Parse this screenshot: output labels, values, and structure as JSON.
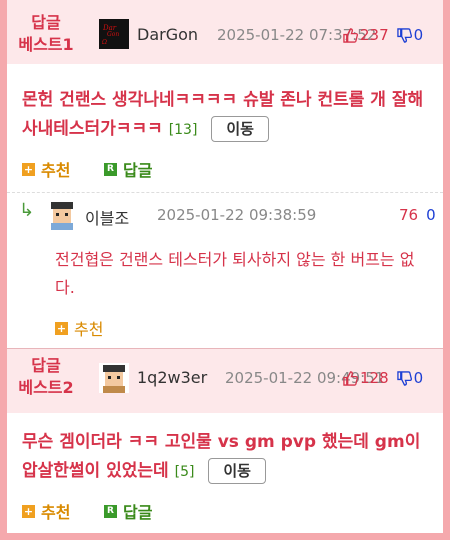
{
  "posts": [
    {
      "rank": "답글\n베스트1",
      "nick": "DarGon",
      "date": "2025-01-22 07:37:52",
      "up": "237",
      "down": "0",
      "title": "몬헌 건랜스 생각나네ㅋㅋㅋㅋ 슈발 존나 컨트롤 개 잘해 사내테스터가ㅋㅋㅋ",
      "count": "[13]",
      "move": "이동",
      "recommend": "추천",
      "reply": "답글"
    },
    {
      "rank": "답글\n베스트2",
      "nick": "1q2w3er",
      "date": "2025-01-22 09:49:51",
      "up": "128",
      "down": "0",
      "title": "무슨 겜이더라 ㅋㅋ 고인물 vs gm pvp 했는데 gm이 압살한썰이 있었는데",
      "count": "[5]",
      "move": "이동",
      "recommend": "추천",
      "reply": "답글"
    }
  ],
  "comment": {
    "nick": "이블조",
    "date": "2025-01-22 09:38:59",
    "up": "76",
    "down": "0",
    "text": "전건협은 건랜스 테스터가 퇴사하지 않는 한 버프는 없다.",
    "recommend": "추천"
  },
  "colors": {
    "accent": "#d6334a",
    "down": "#1d3fd4",
    "green": "#3a8a1a",
    "orange": "#d98a00"
  },
  "icons": [
    "thumbs-up-icon",
    "thumbs-down-icon",
    "plus-icon",
    "reply-r-icon",
    "reply-arrow-icon"
  ]
}
